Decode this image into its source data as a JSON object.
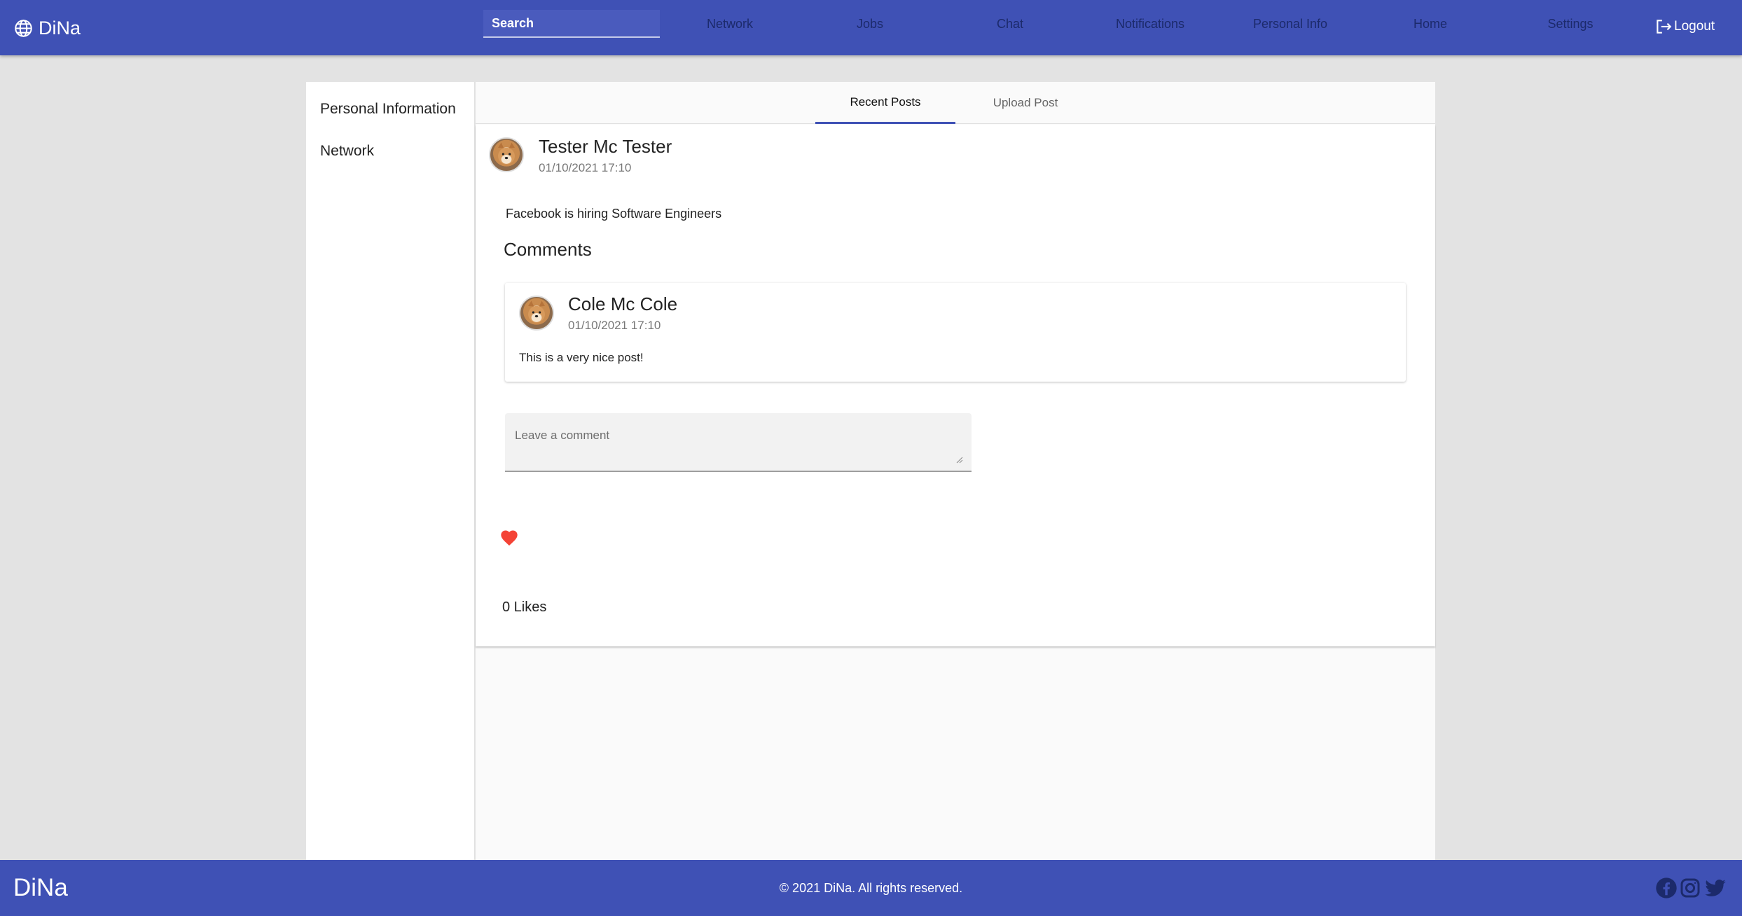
{
  "header": {
    "brand": "DiNa",
    "search_placeholder": "Search",
    "nav": [
      "Network",
      "Jobs",
      "Chat",
      "Notifications",
      "Personal Info",
      "Home",
      "Settings"
    ],
    "logout_label": "Logout"
  },
  "sidebar": {
    "items": [
      {
        "label": "Personal Information"
      },
      {
        "label": "Network"
      }
    ]
  },
  "tabs": [
    {
      "label": "Recent Posts",
      "active": true
    },
    {
      "label": "Upload Post",
      "active": false
    }
  ],
  "post": {
    "author": "Tester Mc Tester",
    "timestamp": "01/10/2021 17:10",
    "text": "Facebook is hiring Software Engineers",
    "comments_title": "Comments",
    "comments": [
      {
        "author": "Cole Mc Cole",
        "timestamp": "01/10/2021 17:10",
        "text": "This is a very nice post!"
      }
    ],
    "comment_placeholder": "Leave a comment",
    "likes_text": "0 Likes"
  },
  "footer": {
    "brand": "DiNa",
    "copyright": "© 2021 DiNa. All rights reserved.",
    "social": [
      "facebook-icon",
      "instagram-icon",
      "twitter-icon"
    ]
  },
  "colors": {
    "primary": "#3f51b5",
    "like": "#f44336",
    "background": "#e3e3e3"
  }
}
